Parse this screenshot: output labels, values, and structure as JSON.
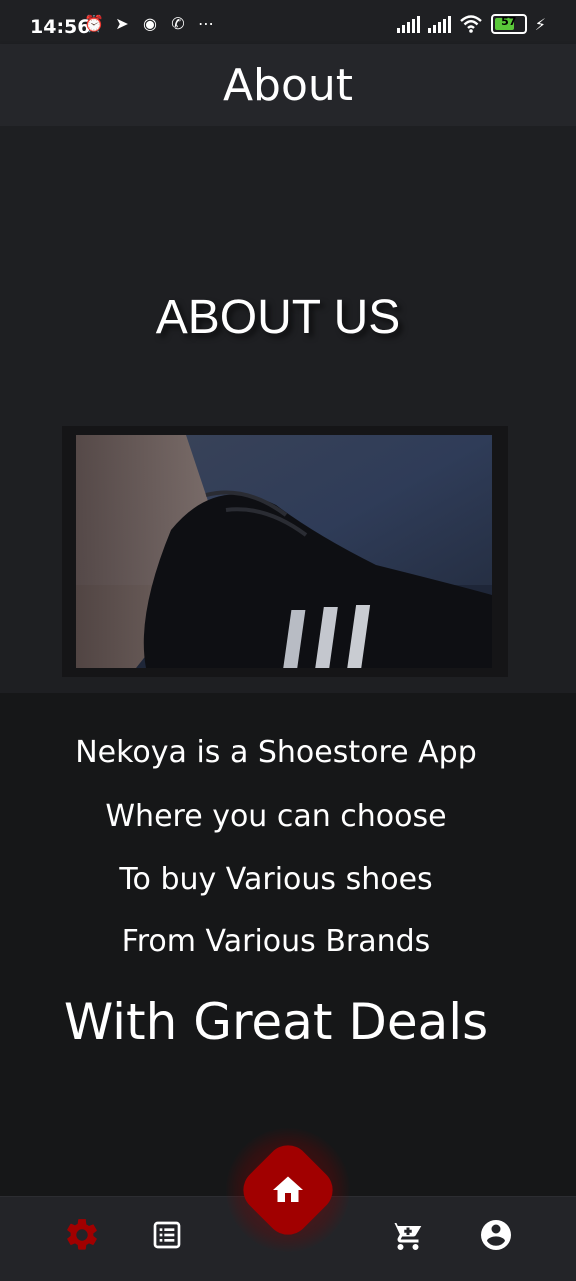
{
  "status_bar": {
    "time": "14:56",
    "battery_level": "57",
    "left_icons": [
      "alarm-icon",
      "telegram-icon",
      "discord-icon",
      "whatsapp-icon",
      "more-icon"
    ],
    "right_icons": [
      "signal-icon",
      "signal-icon",
      "wifi-icon",
      "battery-icon",
      "charging-icon"
    ]
  },
  "app_bar": {
    "title": "About"
  },
  "about": {
    "heading": "ABOUT US",
    "image_label": "shoe-photo"
  },
  "description": {
    "lines": [
      "Nekoya is a Shoestore App",
      "Where you can choose",
      "To buy Various shoes",
      "From Various Brands"
    ],
    "highlight": "With Great Deals"
  },
  "bottom_nav": {
    "items": [
      "settings-icon",
      "list-icon",
      "home-icon",
      "cart-icon",
      "account-icon"
    ],
    "active_color": "#a10000",
    "active_item": "settings-icon"
  },
  "colors": {
    "background": "#1e1f22",
    "app_bar": "#25262a",
    "text_section": "#161718",
    "accent": "#a10000"
  }
}
